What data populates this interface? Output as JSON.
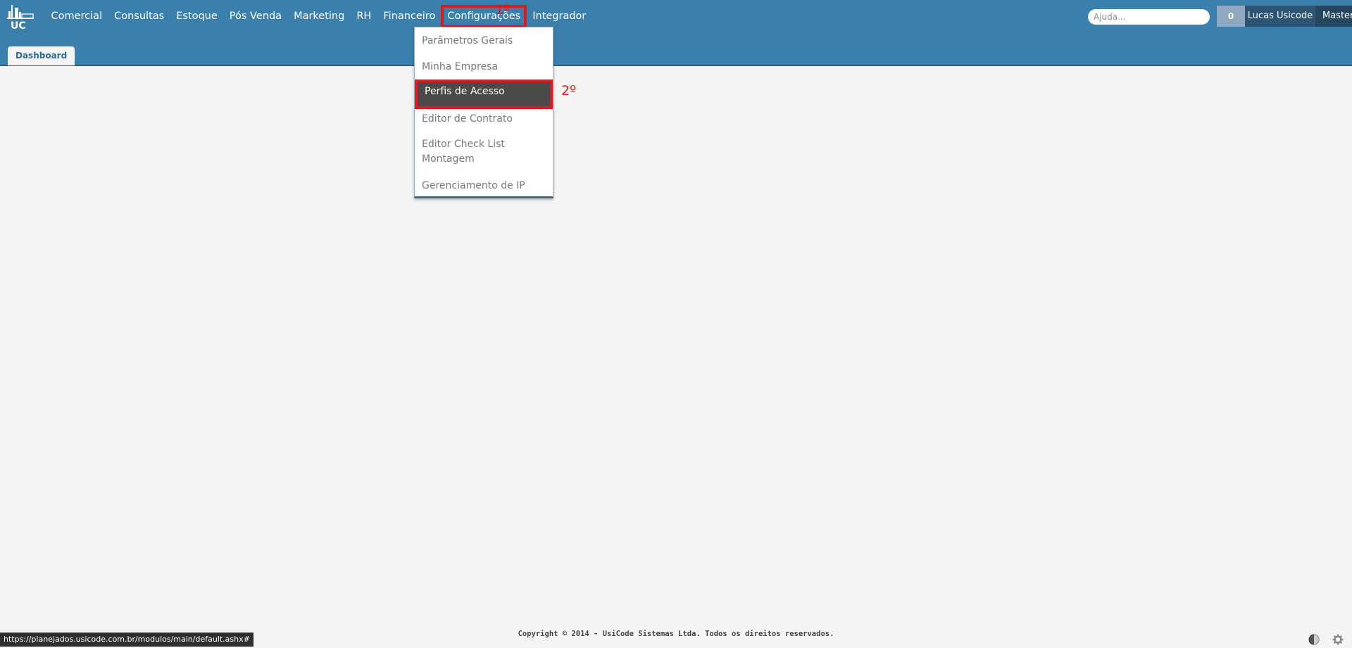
{
  "header": {
    "logo_text": "UC",
    "nav": [
      {
        "label": "Comercial"
      },
      {
        "label": "Consultas"
      },
      {
        "label": "Estoque"
      },
      {
        "label": "Pós Venda"
      },
      {
        "label": "Marketing"
      },
      {
        "label": "RH"
      },
      {
        "label": "Financeiro"
      },
      {
        "label": "Configurações"
      },
      {
        "label": "Integrador"
      }
    ],
    "step1_label": "1º",
    "search_placeholder": "Ajuda...",
    "notifications_count": "0",
    "user_name": "Lucas Usicode",
    "user_role": "Master"
  },
  "tabs": [
    {
      "label": "Dashboard"
    }
  ],
  "dropdown": {
    "items": [
      {
        "label": "Parâmetros Gerais"
      },
      {
        "label": "Minha Empresa"
      },
      {
        "label": "Perfis de Acesso"
      },
      {
        "label": "Editor de Contrato"
      },
      {
        "label": "Editor Check List Montagem"
      },
      {
        "label": "Gerenciamento de IP"
      }
    ],
    "step2_label": "2º"
  },
  "footer": {
    "copyright": "Copyright © 2014 - UsiCode Sistemas Ltda. Todos os direitos reservados."
  },
  "status_url": "https://planejados.usicode.com.br/modulos/main/default.ashx#",
  "colors": {
    "header": "#3b7fad",
    "highlight": "#e2191f",
    "selected_bg": "#4a4a4a"
  },
  "icons": [
    "uc-logo-icon",
    "theme-icon",
    "gear-icon"
  ]
}
